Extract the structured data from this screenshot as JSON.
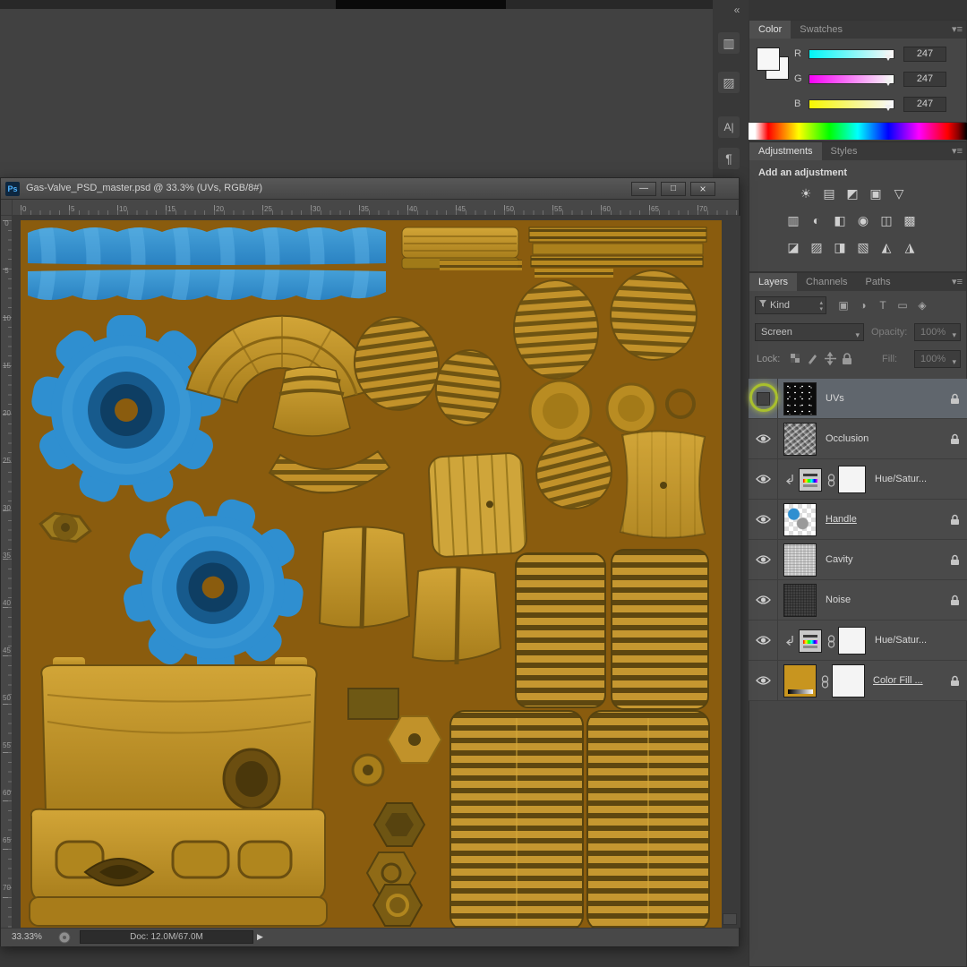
{
  "window": {
    "title": "Gas-Valve_PSD_master.psd @ 33.3% (UVs, RGB/8#)",
    "ps_badge": "Ps",
    "controls": {
      "minimize": "—",
      "maximize": "□",
      "close": "×"
    }
  },
  "rulers": {
    "top": [
      "0",
      "5",
      "10",
      "15",
      "20",
      "25",
      "30",
      "35",
      "40",
      "45",
      "50",
      "55",
      "60",
      "65",
      "70"
    ],
    "left": [
      "0",
      "5",
      "10",
      "15",
      "20",
      "25",
      "30",
      "35",
      "40",
      "45",
      "50",
      "55",
      "60",
      "65",
      "70"
    ]
  },
  "statusbar": {
    "zoom": "33.33%",
    "doc": "Doc: 12.0M/67.0M"
  },
  "dock": {
    "collapse": "«",
    "icons": [
      "align-panel",
      "brush-panel",
      "character-panel",
      "paragraph-panel"
    ],
    "character_glyph": "A|",
    "paragraph_glyph": "¶"
  },
  "color_panel": {
    "tabs": [
      "Color",
      "Swatches"
    ],
    "channels": [
      {
        "label": "R",
        "value": "247"
      },
      {
        "label": "G",
        "value": "247"
      },
      {
        "label": "B",
        "value": "247"
      }
    ]
  },
  "adjustments_panel": {
    "tabs": [
      "Adjustments",
      "Styles"
    ],
    "heading": "Add an adjustment",
    "rows": [
      [
        "brightness-contrast",
        "levels",
        "curves",
        "exposure",
        "vibrance"
      ],
      [
        "hue-saturation",
        "color-balance",
        "black-white",
        "photo-filter",
        "channel-mixer",
        "color-lookup"
      ],
      [
        "invert",
        "posterize",
        "threshold",
        "gradient-map",
        "selective-color",
        "color-lut"
      ]
    ]
  },
  "layers_panel": {
    "tabs": [
      "Layers",
      "Channels",
      "Paths"
    ],
    "kind": "Kind",
    "blend_mode": "Screen",
    "opacity_label": "Opacity:",
    "opacity_value": "100%",
    "lock_label": "Lock:",
    "fill_label": "Fill:",
    "fill_value": "100%",
    "layers": [
      {
        "name": "UVs",
        "visible": false,
        "selected": true,
        "locked": true
      },
      {
        "name": "Occlusion",
        "visible": true,
        "locked": true
      },
      {
        "name": "Hue/Satur...",
        "visible": true,
        "clipped": true
      },
      {
        "name": "Handle",
        "visible": true,
        "locked": true
      },
      {
        "name": "Cavity",
        "visible": true,
        "locked": true
      },
      {
        "name": "Noise",
        "visible": true,
        "locked": true
      },
      {
        "name": "Hue/Satur...",
        "visible": true,
        "clipped": true
      },
      {
        "name": "Color Fill ...",
        "visible": true,
        "locked": true
      }
    ]
  },
  "colors": {
    "canvas_bg": "#8a5c0e",
    "blue": "#2f8fd0",
    "annotation_green": "#a9c02d"
  }
}
